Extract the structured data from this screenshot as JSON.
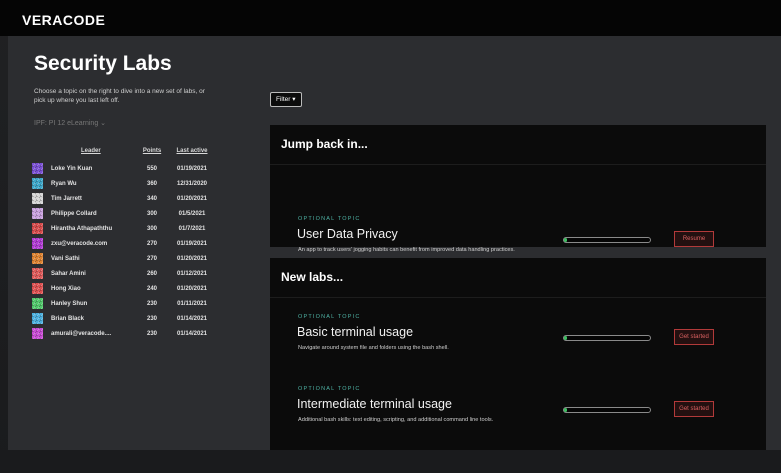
{
  "brand": {
    "logo": "VERACODE"
  },
  "page": {
    "title": "Security Labs",
    "intro": "Choose a topic on the right to dive into a new set of labs, or pick up where you last left off.",
    "ipf_selector": "IPF: PI 12 eLearning ⌄"
  },
  "leaderboard": {
    "headers": {
      "leader": "Leader",
      "points": "Points",
      "last_active": "Last active"
    },
    "rows": [
      {
        "name": "Loke Yin Kuan",
        "points": "550",
        "last_active": "01/19/2021",
        "avatar_color": "#7a4fd6"
      },
      {
        "name": "Ryan Wu",
        "points": "360",
        "last_active": "12/31/2020",
        "avatar_color": "#3ba7c9"
      },
      {
        "name": "Tim Jarrett",
        "points": "340",
        "last_active": "01/20/2021",
        "avatar_color": "#d6d6d6"
      },
      {
        "name": "Philippe Collard",
        "points": "300",
        "last_active": "01/5/2021",
        "avatar_color": "#c9a0e0"
      },
      {
        "name": "Hirantha Athapaththu",
        "points": "300",
        "last_active": "01/7/2021",
        "avatar_color": "#d94a4a"
      },
      {
        "name": "zxu@veracode.com",
        "points": "270",
        "last_active": "01/19/2021",
        "avatar_color": "#b23ad6"
      },
      {
        "name": "Vani Sathi",
        "points": "270",
        "last_active": "01/20/2021",
        "avatar_color": "#e0832f"
      },
      {
        "name": "Sahar Amini",
        "points": "260",
        "last_active": "01/12/2021",
        "avatar_color": "#e05a5a"
      },
      {
        "name": "Hong Xiao",
        "points": "240",
        "last_active": "01/20/2021",
        "avatar_color": "#e05050"
      },
      {
        "name": "Hanley Shun",
        "points": "230",
        "last_active": "01/11/2021",
        "avatar_color": "#4fc96a"
      },
      {
        "name": "Brian Black",
        "points": "230",
        "last_active": "01/14/2021",
        "avatar_color": "#4ab0e0"
      },
      {
        "name": "amurali@veracode....",
        "points": "230",
        "last_active": "01/14/2021",
        "avatar_color": "#c94ad6"
      }
    ]
  },
  "filter": {
    "label": "Filter ▾"
  },
  "jump_back": {
    "title": "Jump back in...",
    "card": {
      "tag": "OPTIONAL TOPIC",
      "title": "User Data Privacy",
      "description": "An app to track users' jogging habits can benefit from improved data handling practices.",
      "progress": 0.03,
      "action": "Resume"
    }
  },
  "new_labs": {
    "title": "New labs...",
    "cards": [
      {
        "tag": "OPTIONAL TOPIC",
        "title": "Basic terminal usage",
        "description": "Navigate around system file and folders using the bash shell.",
        "progress": 0.03,
        "action": "Get started"
      },
      {
        "tag": "OPTIONAL TOPIC",
        "title": "Intermediate terminal usage",
        "description": "Additional bash skills: text editing, scripting, and additional command line tools.",
        "progress": 0.03,
        "action": "Get started"
      }
    ]
  },
  "colors": {
    "accent_green": "#3fbf62",
    "tag_teal": "#4fb3a5",
    "action_red": "#d96060"
  }
}
